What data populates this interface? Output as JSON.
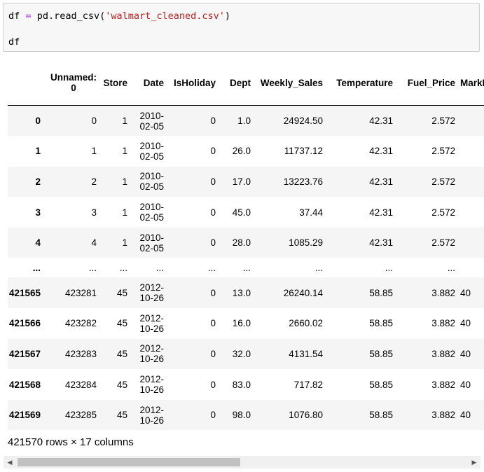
{
  "code": {
    "line1_var": "df",
    "line1_op": "=",
    "line1_func": "pd.read_csv(",
    "line1_str": "'walmart_cleaned.csv'",
    "line1_close": ")",
    "line2": "df"
  },
  "table": {
    "headers": [
      "",
      "Unnamed: 0",
      "Store",
      "Date",
      "IsHoliday",
      "Dept",
      "Weekly_Sales",
      "Temperature",
      "Fuel_Price",
      "MarkD"
    ],
    "header_unnamed_line1": "Unnamed:",
    "header_unnamed_line2": "0",
    "rows": [
      {
        "idx": "0",
        "unnamed": "0",
        "store": "1",
        "date1": "2010-",
        "date2": "02-05",
        "holiday": "0",
        "dept": "1.0",
        "sales": "24924.50",
        "temp": "42.31",
        "fuel": "2.572",
        "markd": ""
      },
      {
        "idx": "1",
        "unnamed": "1",
        "store": "1",
        "date1": "2010-",
        "date2": "02-05",
        "holiday": "0",
        "dept": "26.0",
        "sales": "11737.12",
        "temp": "42.31",
        "fuel": "2.572",
        "markd": ""
      },
      {
        "idx": "2",
        "unnamed": "2",
        "store": "1",
        "date1": "2010-",
        "date2": "02-05",
        "holiday": "0",
        "dept": "17.0",
        "sales": "13223.76",
        "temp": "42.31",
        "fuel": "2.572",
        "markd": ""
      },
      {
        "idx": "3",
        "unnamed": "3",
        "store": "1",
        "date1": "2010-",
        "date2": "02-05",
        "holiday": "0",
        "dept": "45.0",
        "sales": "37.44",
        "temp": "42.31",
        "fuel": "2.572",
        "markd": ""
      },
      {
        "idx": "4",
        "unnamed": "4",
        "store": "1",
        "date1": "2010-",
        "date2": "02-05",
        "holiday": "0",
        "dept": "28.0",
        "sales": "1085.29",
        "temp": "42.31",
        "fuel": "2.572",
        "markd": ""
      },
      {
        "idx": "...",
        "unnamed": "...",
        "store": "...",
        "date1": "...",
        "date2": "",
        "holiday": "...",
        "dept": "...",
        "sales": "...",
        "temp": "...",
        "fuel": "...",
        "markd": ""
      },
      {
        "idx": "421565",
        "unnamed": "423281",
        "store": "45",
        "date1": "2012-",
        "date2": "10-26",
        "holiday": "0",
        "dept": "13.0",
        "sales": "26240.14",
        "temp": "58.85",
        "fuel": "3.882",
        "markd": "40"
      },
      {
        "idx": "421566",
        "unnamed": "423282",
        "store": "45",
        "date1": "2012-",
        "date2": "10-26",
        "holiday": "0",
        "dept": "16.0",
        "sales": "2660.02",
        "temp": "58.85",
        "fuel": "3.882",
        "markd": "40"
      },
      {
        "idx": "421567",
        "unnamed": "423283",
        "store": "45",
        "date1": "2012-",
        "date2": "10-26",
        "holiday": "0",
        "dept": "32.0",
        "sales": "4131.54",
        "temp": "58.85",
        "fuel": "3.882",
        "markd": "40"
      },
      {
        "idx": "421568",
        "unnamed": "423284",
        "store": "45",
        "date1": "2012-",
        "date2": "10-26",
        "holiday": "0",
        "dept": "83.0",
        "sales": "717.82",
        "temp": "58.85",
        "fuel": "3.882",
        "markd": "40"
      },
      {
        "idx": "421569",
        "unnamed": "423285",
        "store": "45",
        "date1": "2012-",
        "date2": "10-26",
        "holiday": "0",
        "dept": "98.0",
        "sales": "1076.80",
        "temp": "58.85",
        "fuel": "3.882",
        "markd": "40"
      }
    ]
  },
  "footer": "421570 rows × 17 columns",
  "scrollbar": {
    "left_arrow": "◀",
    "right_arrow": "▶"
  }
}
